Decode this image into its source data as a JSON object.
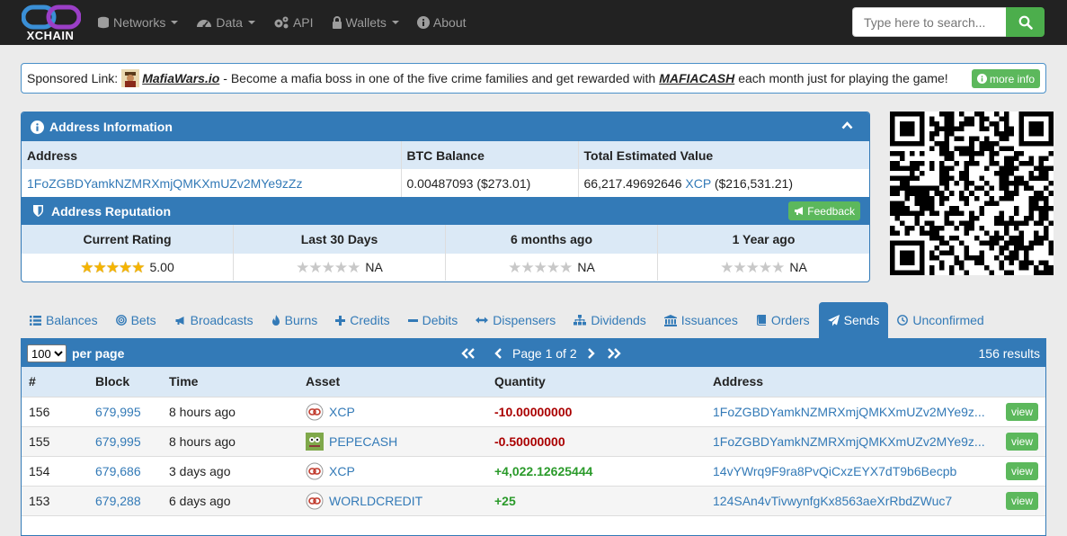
{
  "brand": {
    "name": "XCHAIN"
  },
  "nav": [
    {
      "label": "Networks",
      "icon": "database-icon",
      "dropdown": true
    },
    {
      "label": "Data",
      "icon": "dashboard-icon",
      "dropdown": true
    },
    {
      "label": "API",
      "icon": "cogs-icon",
      "dropdown": false
    },
    {
      "label": "Wallets",
      "icon": "lock-icon",
      "dropdown": true
    },
    {
      "label": "About",
      "icon": "info-icon",
      "dropdown": false
    }
  ],
  "search": {
    "placeholder": "Type here to search..."
  },
  "sponsor": {
    "prefix": "Sponsored Link:",
    "site": "MafiaWars.io",
    "text1": "- Become a mafia boss in one of the five crime families and get rewarded with",
    "token": "MAFIACASH",
    "text2": "each month just for playing the game!",
    "more_label": "more info"
  },
  "address_info": {
    "title": "Address Information",
    "headers": [
      "Address",
      "BTC Balance",
      "Total Estimated Value"
    ],
    "address": "1FoZGBDYamkNZMRXmjQMKXmUZv2MYe9zZz",
    "btc_balance": "0.00487093 ($273.01)",
    "total_value_amount": "66,217.49692646",
    "total_value_asset": "XCP",
    "total_value_usd": "($216,531.21)"
  },
  "reputation": {
    "title": "Address Reputation",
    "feedback_label": "Feedback",
    "columns": [
      {
        "label": "Current Rating",
        "stars": 5,
        "value": "5.00"
      },
      {
        "label": "Last 30 Days",
        "stars": 0,
        "value": "NA"
      },
      {
        "label": "6 months ago",
        "stars": 0,
        "value": "NA"
      },
      {
        "label": "1 Year ago",
        "stars": 0,
        "value": "NA"
      }
    ]
  },
  "tabs": [
    {
      "label": "Balances",
      "icon": "list-icon",
      "active": false
    },
    {
      "label": "Bets",
      "icon": "bullseye-icon",
      "active": false
    },
    {
      "label": "Broadcasts",
      "icon": "bullhorn-icon",
      "active": false
    },
    {
      "label": "Burns",
      "icon": "fire-icon",
      "active": false
    },
    {
      "label": "Credits",
      "icon": "plus-icon",
      "active": false
    },
    {
      "label": "Debits",
      "icon": "minus-icon",
      "active": false
    },
    {
      "label": "Dispensers",
      "icon": "exchange-icon",
      "active": false
    },
    {
      "label": "Dividends",
      "icon": "sitemap-icon",
      "active": false
    },
    {
      "label": "Issuances",
      "icon": "bank-icon",
      "active": false
    },
    {
      "label": "Orders",
      "icon": "book-icon",
      "active": false
    },
    {
      "label": "Sends",
      "icon": "send-icon",
      "active": true
    },
    {
      "label": "Unconfirmed",
      "icon": "clock-icon",
      "active": false
    }
  ],
  "sends": {
    "per_page_value": "100",
    "per_page_label": "per page",
    "page_text": "Page 1 of 2",
    "results_text": "156 results",
    "headers": [
      "#",
      "Block",
      "Time",
      "Asset",
      "Quantity",
      "Address"
    ],
    "rows": [
      {
        "num": "156",
        "block": "679,995",
        "time": "8 hours ago",
        "asset": "XCP",
        "asset_icon": "xcp-icon",
        "quantity": "-10.00000000",
        "sign": "neg",
        "address": "1FoZGBDYamkNZMRXmjQMKXmUZv2MYe9z...",
        "view": "view"
      },
      {
        "num": "155",
        "block": "679,995",
        "time": "8 hours ago",
        "asset": "PEPECASH",
        "asset_icon": "pepecash-icon",
        "quantity": "-0.50000000",
        "sign": "neg",
        "address": "1FoZGBDYamkNZMRXmjQMKXmUZv2MYe9z...",
        "view": "view"
      },
      {
        "num": "154",
        "block": "679,686",
        "time": "3 days ago",
        "asset": "XCP",
        "asset_icon": "xcp-icon",
        "quantity": "+4,022.12625444",
        "sign": "pos",
        "address": "14vYWrq9F9ra8PvQiCxzEYX7dT9b6Becpb",
        "view": "view"
      },
      {
        "num": "153",
        "block": "679,288",
        "time": "6 days ago",
        "asset": "WORLDCREDIT",
        "asset_icon": "xcp-icon",
        "quantity": "+25",
        "sign": "pos",
        "address": "124SAn4vTivwynfgKx8563aeXrRbdZWuc7",
        "view": "view"
      }
    ]
  },
  "colors": {
    "primary": "#337ab7",
    "success": "#5cb85c",
    "navbar": "#222222",
    "negative": "#aa0000",
    "positive": "#2a9a2a"
  }
}
